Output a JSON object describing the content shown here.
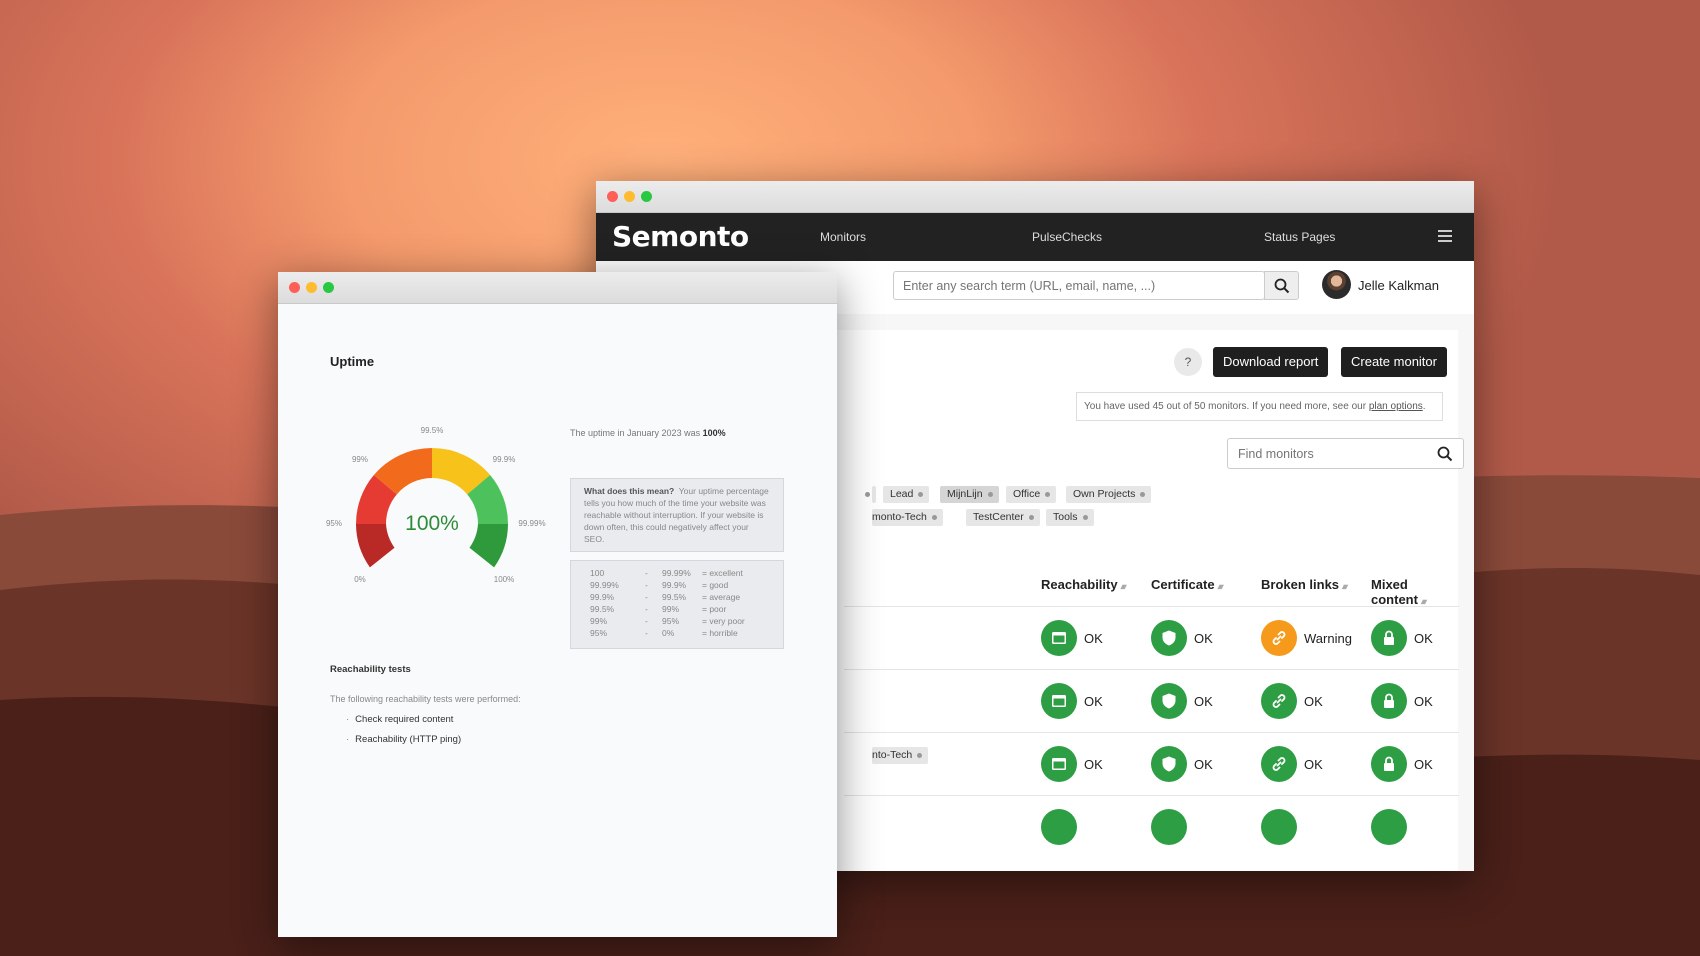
{
  "back_window": {
    "nav": {
      "logo": "Semonto",
      "links": [
        "Monitors",
        "PulseChecks",
        "Status Pages"
      ]
    },
    "topbar": {
      "search_placeholder": "Enter any search term (URL, email, name, ...)",
      "user_name": "Jelle Kalkman"
    },
    "actions": {
      "help_label": "?",
      "download_label": "Download report",
      "create_label": "Create monitor"
    },
    "notice": {
      "text": "You have used 45 out of 50 monitors. If you need more, see our ",
      "link": "plan options",
      "end": "."
    },
    "find_placeholder": "Find monitors",
    "tags_row1": [
      "Lead",
      "MijnLijn",
      "Office",
      "Own Projects"
    ],
    "tags_row2": [
      "monto-Tech",
      "TestCenter",
      "Tools"
    ],
    "row_tag": "nto-Tech",
    "columns": [
      "Reachability",
      "Certificate",
      "Broken links",
      "Mixed content"
    ],
    "rows": [
      [
        "OK",
        "OK",
        "Warning",
        "OK"
      ],
      [
        "OK",
        "OK",
        "OK",
        "OK"
      ],
      [
        "OK",
        "OK",
        "OK",
        "OK"
      ]
    ],
    "colors": {
      "ok": "#2e9e45",
      "warning": "#f59a1b",
      "nav": "#222222"
    }
  },
  "front_window": {
    "title": "Uptime",
    "gauge": {
      "value": "100%",
      "ticks": [
        "0%",
        "95%",
        "99%",
        "99.5%",
        "99.9%",
        "99.99%",
        "100%"
      ]
    },
    "uptime_text": "The uptime in January 2023 was ",
    "uptime_value": "100%",
    "info": {
      "heading": "What does this mean?",
      "body": "Your uptime percentage tells you how much of the time your website was reachable without interruption. If your website is down often, this could negatively affect your SEO."
    },
    "scale": [
      [
        "100",
        "-",
        "99.99%",
        "= excellent"
      ],
      [
        "99.99%",
        "-",
        "99.9%",
        "= good"
      ],
      [
        "99.9%",
        "-",
        "99.5%",
        "= average"
      ],
      [
        "99.5%",
        "-",
        "99%",
        "= poor"
      ],
      [
        "99%",
        "-",
        "95%",
        "= very poor"
      ],
      [
        "95%",
        "-",
        "0%",
        "= horrible"
      ]
    ],
    "reach_title": "Reachability tests",
    "reach_text": "The following reachability tests were performed:",
    "tests": [
      "Check required content",
      "Reachability (HTTP ping)"
    ]
  }
}
